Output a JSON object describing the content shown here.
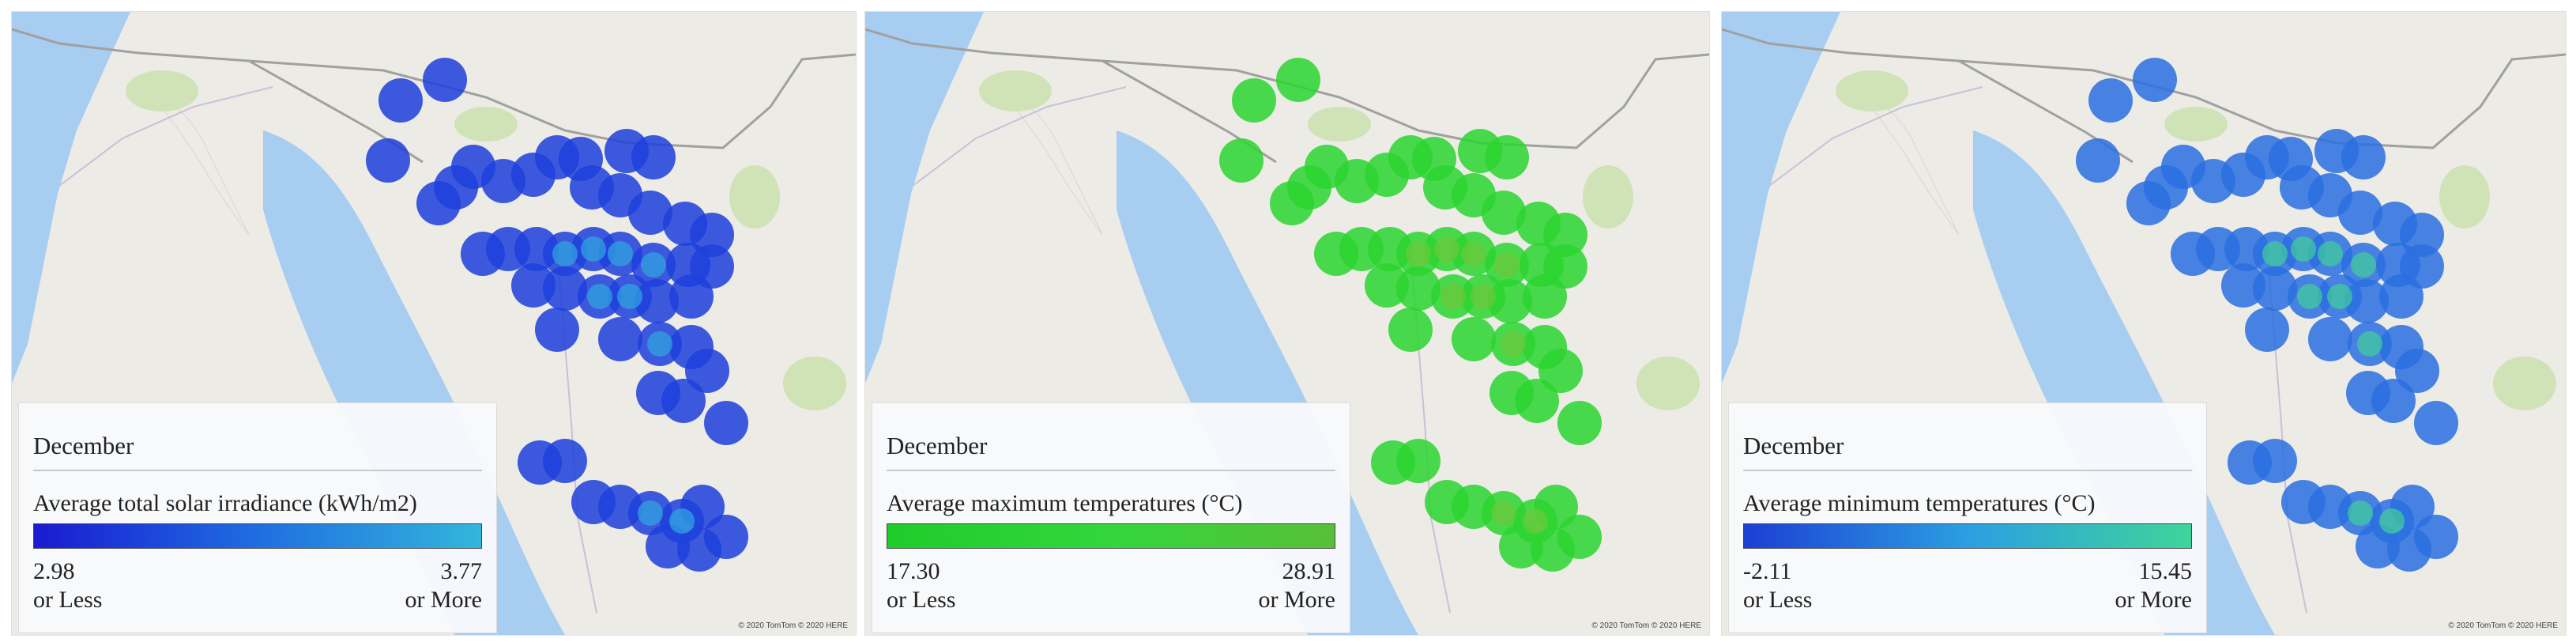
{
  "panels": [
    {
      "id": "solar",
      "month": "December",
      "metric": "Average total solar irradiance (kWh/m2)",
      "min_value": "2.98",
      "min_label": "or Less",
      "max_value": "3.77",
      "max_label": "or More",
      "gradient": [
        "#1a1ad2",
        "#1f6ee0",
        "#33b6dc"
      ],
      "point_color": "#1d3fdc",
      "core_color": "#2fa8e0",
      "copyright": "© 2020 TomTom © 2020 HERE"
    },
    {
      "id": "tmax",
      "month": "December",
      "metric": "Average maximum temperatures (°C)",
      "min_value": "17.30",
      "min_label": "or Less",
      "max_value": "28.91",
      "max_label": "or More",
      "gradient": [
        "#1fcc2a",
        "#33d63d",
        "#58c038"
      ],
      "point_color": "#2bd52f",
      "core_color": "#6cc83a",
      "copyright": "© 2020 TomTom © 2020 HERE"
    },
    {
      "id": "tmin",
      "month": "December",
      "metric": "Average minimum temperatures (°C)",
      "min_value": "-2.11",
      "min_label": "or Less",
      "max_value": "15.45",
      "max_label": "or More",
      "gradient": [
        "#1c3fd4",
        "#2b9fe2",
        "#3fd49a"
      ],
      "point_color": "#2a6ee0",
      "core_color": "#40d09a",
      "copyright": "© 2020 TomTom © 2020 HERE"
    }
  ],
  "map_colors": {
    "land": "#ecebe6",
    "water": "#a7cdf1",
    "park": "#cfe3b7",
    "border": "#a0a0a0",
    "road": "#c9c0d8"
  }
}
